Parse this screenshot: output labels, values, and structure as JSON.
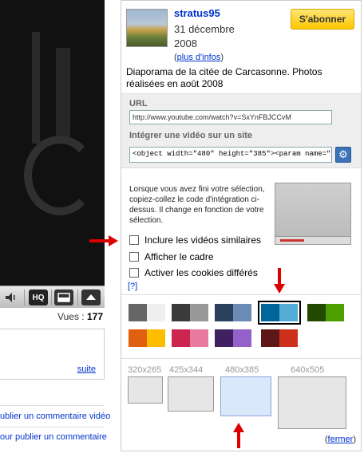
{
  "player": {
    "hq_label": "HQ"
  },
  "stats": {
    "views_label": "Vues :",
    "views_count": "177"
  },
  "description_box": {
    "suite_link": "suite"
  },
  "comments": {
    "link1": "ublier un commentaire vidéo",
    "link2": "our publier un commentaire"
  },
  "channel": {
    "username": "stratus95",
    "date_line1": "31 décembre",
    "date_line2": "2008",
    "more_info_open": "(",
    "more_info_link": "plus d'infos",
    "more_info_close": ")",
    "subscribe_label": "S'abonner"
  },
  "video": {
    "description": "Diaporama de la citée de Carcasonne. Photos réalisées en août 2008"
  },
  "share": {
    "url_label": "URL",
    "url_value": "http://www.youtube.com/watch?v=SxYnFBJCCvM",
    "embed_label": "Intégrer une vidéo sur un site",
    "embed_value": "<object width=\"480\" height=\"385\"><param name=\"m"
  },
  "options": {
    "instructions": "Lorsque vous avez fini votre sélection, copiez-collez le code d'intégration ci-dessus. Il change en fonction de votre sélection.",
    "checkbox1": "Inclure les vidéos similaires",
    "checkbox2": "Afficher le cadre",
    "checkbox3": "Activer les cookies différés",
    "help": "[?]"
  },
  "colors": {
    "swatches": [
      [
        "#666666",
        "#efefef"
      ],
      [
        "#3a3a3a",
        "#999999"
      ],
      [
        "#2b405b",
        "#6b8ab6"
      ],
      [
        "#006699",
        "#54abd6"
      ],
      [
        "#234900",
        "#4e9e00"
      ],
      [
        "#e1600f",
        "#febd01"
      ],
      [
        "#cc2550",
        "#e87a9f"
      ],
      [
        "#402061",
        "#9461ca"
      ],
      [
        "#5d1719",
        "#cd311b"
      ]
    ],
    "selected_index": 3,
    "accent_link": "#0033cc",
    "arrow_red": "#dd0000"
  },
  "sizes": {
    "options": [
      "320x265",
      "425x344",
      "480x385",
      "640x505"
    ],
    "selected_index": 2
  },
  "footer": {
    "close_open": "(",
    "close_link": "fermer",
    "close_close": ")"
  }
}
